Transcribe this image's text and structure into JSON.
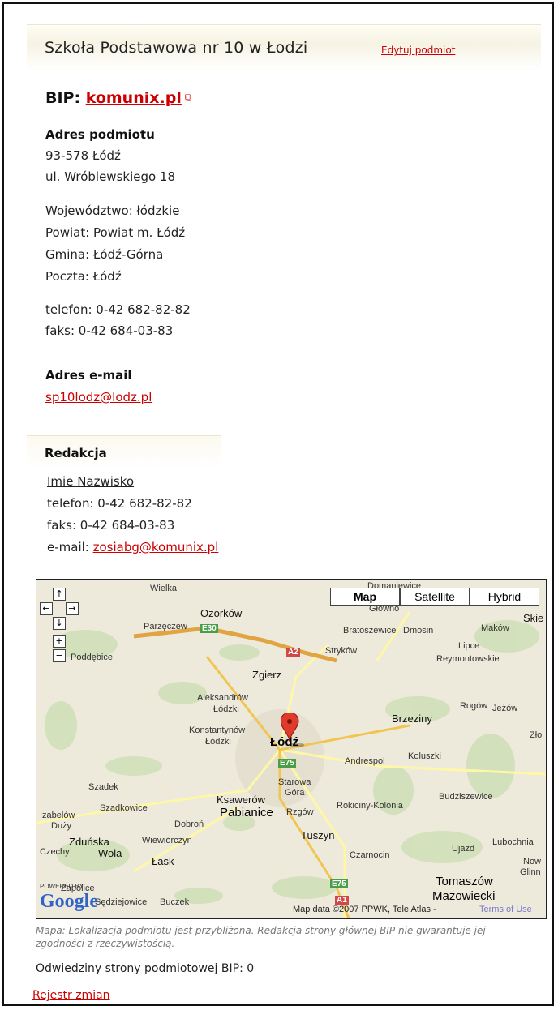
{
  "header": {
    "title": "Szkoła Podstawowa nr 10 w Łodzi",
    "edit_link": "Edytuj podmiot"
  },
  "bip": {
    "prefix": "BIP:",
    "link": "komunix.pl",
    "ext_icon": "external-link-icon"
  },
  "address": {
    "heading": "Adres podmiotu",
    "postal": "93-578 Łódź",
    "street": "ul. Wróblewskiego 18",
    "voivodeship": "Województwo: łódzkie",
    "county": "Powiat: Powiat m. Łódź",
    "commune": "Gmina: Łódź-Górna",
    "post": "Poczta: Łódź",
    "phone": "telefon: 0-42 682-82-82",
    "fax": "faks: 0-42 684-03-83"
  },
  "email": {
    "heading": "Adres e-mail",
    "value": "sp10lodz@lodz.pl"
  },
  "editorial": {
    "heading": "Redakcja",
    "name": "Imie Nazwisko",
    "phone": "telefon: 0-42 682-82-82",
    "fax": "faks: 0-42 684-03-83",
    "email_label": "e-mail:",
    "email": "zosiabg@komunix.pl"
  },
  "map": {
    "types": [
      "Map",
      "Satellite",
      "Hybrid"
    ],
    "selected_type": "Map",
    "controls": [
      "↑",
      "←",
      "→",
      "↓",
      "+",
      "−"
    ],
    "attribution": "Map data ©2007 PPWK, Tele Atlas -",
    "terms": "Terms of Use",
    "logo": "Google",
    "powered": "POWERED BY",
    "places": {
      "wielka": "Wielka",
      "ozorkow": "Ozorków",
      "parzeczew": "Parzęczew",
      "poddebice": "Poddębice",
      "glowno": "Głowno",
      "domaniewice": "Domaniewice",
      "bratoszewice": "Bratoszewice",
      "dmosin": "Dmosin",
      "makow": "Maków",
      "skie": "Skie",
      "strykow": "Stryków",
      "lipce": "Lipce",
      "reymontowskie": "Reymontowskie",
      "zgierz": "Zgierz",
      "aleksandrow": "Aleksandrów",
      "lodzki1": "Łódzki",
      "konstantynow": "Konstantynów",
      "lodzki2": "Łódzki",
      "lodz": "Łódź",
      "brzeziny": "Brzeziny",
      "rogow": "Rogów",
      "jezow": "Jeżów",
      "zlo": "Zło",
      "andrespol": "Andrespol",
      "koluszki": "Koluszki",
      "szadek": "Szadek",
      "starowa": "Starowa",
      "gora": "Góra",
      "ksawerow": "Ksawerów",
      "budziszewice": "Budziszewice",
      "szadkowice": "Szadkowice",
      "pabianice": "Pabianice",
      "rzgow": "Rzgów",
      "rokiciny": "Rokiciny-Kolonia",
      "izabelow": "Izabelów",
      "duzy": "Duży",
      "dobron": "Dobroń",
      "tuszyn": "Tuszyn",
      "zdunska": "Zduńska",
      "wola": "Wola",
      "wiewiorczyn": "Wiewiórczyn",
      "lask": "Łask",
      "czechy": "Czechy",
      "czarnocin": "Czarnocin",
      "ujazd": "Ujazd",
      "lubochnia": "Lubochnia",
      "nowe": "Now",
      "glinn": "Glinn",
      "tomaszow": "Tomaszów",
      "mazowiecki": "Mazowiecki",
      "sedziejowice": "Sędziejowice",
      "buczek": "Buczek",
      "dzbolice": "Zapolice"
    },
    "roads": {
      "e30": "E30",
      "a2": "A2",
      "e75a": "E75",
      "e75b": "E75",
      "a1": "A1"
    }
  },
  "note": "Mapa: Lokalizacja podmiotu jest przybliżona. Redakcja strony głównej BIP nie gwarantuje jej zgodności z rzeczywistością.",
  "visits": "Odwiedziny strony podmiotowej BIP: 0",
  "changelog": "Rejestr zmian"
}
